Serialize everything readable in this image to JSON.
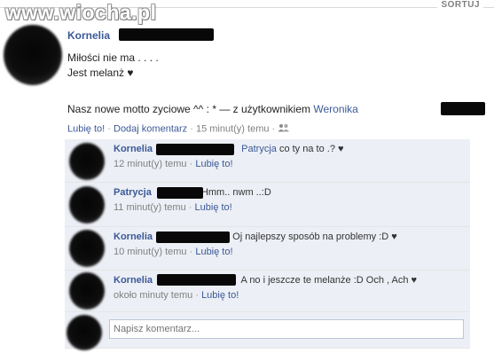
{
  "header": {
    "sort_label": "SORTUJ",
    "watermark": "www.wiocha.pl"
  },
  "post": {
    "author": "Kornelia",
    "line1": "Miłości nie ma . . . .",
    "line2": "Jest melanż ♥",
    "motto": "Nasz nowe motto zyciowe ^^ : * — z użytkownikiem",
    "tagged": "Weronika",
    "like": "Lubię to!",
    "comment": "Dodaj komentarz",
    "time": "15 minut(y) temu",
    "sep": "·"
  },
  "comments": [
    {
      "author": "Kornelia",
      "mention": "Patrycja",
      "text": "co ty na to .? ♥",
      "time": "12 minut(y) temu",
      "like": "Lubię to!"
    },
    {
      "author": "Patrycja",
      "text": "Hmm.. nwm ..:D",
      "time": "11 minut(y) temu",
      "like": "Lubię to!"
    },
    {
      "author": "Kornelia",
      "text": "Oj najlepszy sposób na problemy :D ♥",
      "time": "10 minut(y) temu",
      "like": "Lubię to!"
    },
    {
      "author": "Kornelia",
      "text": "A no i jeszcze te melanże :D Och , Ach ♥",
      "time": "około minuty temu",
      "like": "Lubię to!"
    }
  ],
  "composer": {
    "placeholder": "Napisz komentarz..."
  }
}
